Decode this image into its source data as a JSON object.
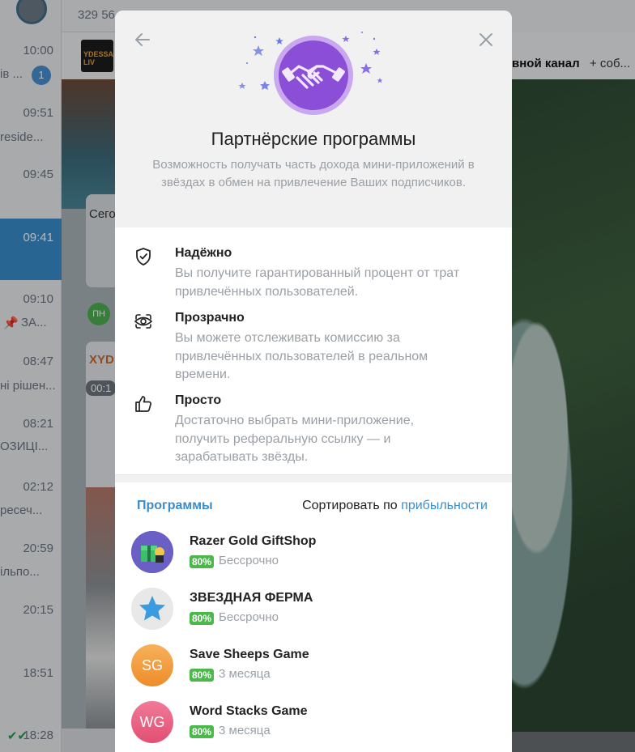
{
  "background": {
    "header_text": "329 56",
    "chat_times": [
      "10:00",
      "09:51",
      "09:45",
      "09:41",
      "09:10",
      "08:47",
      "08:21",
      "02:12",
      "20:59",
      "20:15",
      "18:51",
      "18:28"
    ],
    "chat_snippets": [
      "ів ...",
      "reside...",
      "",
      "",
      "ЗА...",
      "ні рішен...",
      "ОЗИЦІ...",
      "ресеч...",
      "...",
      "ільпо...",
      "",
      ""
    ],
    "unread_badge": "1",
    "pinned_channel_text": "вной канал",
    "pinned_more_text": "+ соб...",
    "pin_thumb_text": "YDESSA LIV",
    "bubble_text": "Сего",
    "bubble_initials": "ПН",
    "bubble_sender": "XYD",
    "bubble_timer": "00:1"
  },
  "modal": {
    "title": "Партнёрские программы",
    "subtitle": "Возможность получать часть дохода мини-приложений в звёздах в обмен на привлечение Ваших подписчиков.",
    "features": [
      {
        "icon": "shield-check-icon",
        "name": "Надёжно",
        "desc": "Вы получите гарантированный процент от трат привлечённых пользователей."
      },
      {
        "icon": "eye-sparkle-icon",
        "name": "Прозрачно",
        "desc": "Вы можете отслеживать комиссию за привлечённых пользователей в реальном времени."
      },
      {
        "icon": "thumbs-up-icon",
        "name": "Просто",
        "desc": "Достаточно выбрать мини-приложение, получить реферальную ссылку — и зарабатывать звёзды."
      }
    ],
    "programs_title": "Программы",
    "sort_prefix": "Сортировать по",
    "sort_value": "прибыльности",
    "programs": [
      {
        "name": "Razer Gold GiftShop",
        "percent": "80%",
        "term": "Бессрочно",
        "avatar_text": "",
        "avatar_color": "#6a5fc4"
      },
      {
        "name": "ЗВЕЗДНАЯ ФЕРМА",
        "percent": "80%",
        "term": "Бессрочно",
        "avatar_text": "",
        "avatar_color": "#e8e8e8"
      },
      {
        "name": "Save Sheeps Game",
        "percent": "80%",
        "term": "3 месяца",
        "avatar_text": "SG",
        "avatar_color": "#f3a03a"
      },
      {
        "name": "Word Stacks Game",
        "percent": "80%",
        "term": "3 месяца",
        "avatar_text": "WG",
        "avatar_color": "#ea5a7f"
      }
    ]
  },
  "colors": {
    "accent": "#3a8ccb",
    "badge_green": "#4cb84c",
    "hero_purple": "#8a4fd6"
  }
}
